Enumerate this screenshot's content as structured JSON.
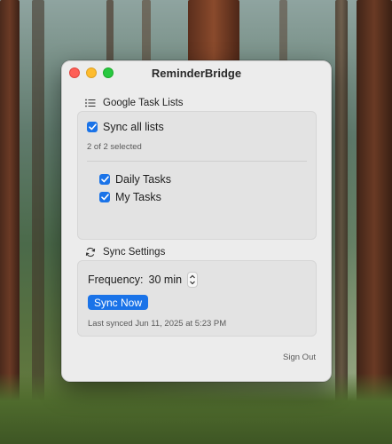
{
  "window": {
    "title": "ReminderBridge"
  },
  "task_lists": {
    "header": "Google Task Lists",
    "header_icon": "list-icon",
    "sync_all_label": "Sync all lists",
    "sync_all_checked": true,
    "selected_count_text": "2 of 2 selected",
    "items": [
      {
        "label": "Daily Tasks",
        "checked": true
      },
      {
        "label": "My Tasks",
        "checked": true
      }
    ]
  },
  "sync_settings": {
    "header": "Sync Settings",
    "header_icon": "sync-arrows-icon",
    "frequency_label": "Frequency:",
    "frequency_value": "30 min",
    "sync_now_label": "Sync Now",
    "last_synced_text": "Last synced Jun 11, 2025 at 5:23 PM"
  },
  "footer": {
    "sign_out_label": "Sign Out"
  },
  "colors": {
    "accent": "#1a73e8",
    "close": "#fe5f57",
    "minimize": "#febc2e",
    "zoom": "#28c840"
  }
}
